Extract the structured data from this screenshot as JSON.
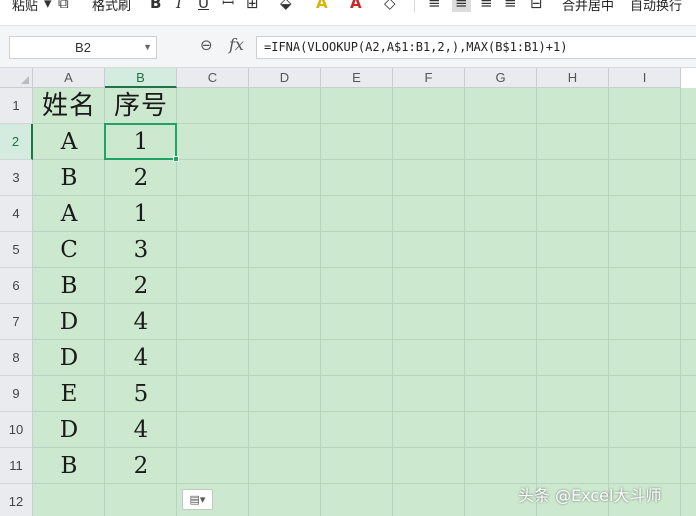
{
  "toolbar": {
    "paste_label": "粘贴",
    "format_painter_label": "格式刷",
    "merge_center_label": "合并居中",
    "wrap_text_label": "自动换行",
    "bold_label": "B",
    "italic_label": "I",
    "underline_label": "U",
    "font_color_label": "A",
    "highlight_label": "A"
  },
  "formula_bar": {
    "name_box": "B2",
    "fx_label": "fx",
    "formula": "=IFNA(VLOOKUP(A2,A$1:B1,2,),MAX(B$1:B1)+1)"
  },
  "columns": [
    "A",
    "B",
    "C",
    "D",
    "E",
    "F",
    "G",
    "H",
    "I"
  ],
  "rows": [
    "1",
    "2",
    "3",
    "4",
    "5",
    "6",
    "7",
    "8",
    "9",
    "10",
    "11",
    "12"
  ],
  "active_cell": {
    "column": "B",
    "row": "2"
  },
  "table": {
    "headers": [
      "姓名",
      "序号"
    ],
    "rows": [
      [
        "A",
        "1"
      ],
      [
        "B",
        "2"
      ],
      [
        "A",
        "1"
      ],
      [
        "C",
        "3"
      ],
      [
        "B",
        "2"
      ],
      [
        "D",
        "4"
      ],
      [
        "D",
        "4"
      ],
      [
        "E",
        "5"
      ],
      [
        "D",
        "4"
      ],
      [
        "B",
        "2"
      ]
    ]
  },
  "watermark": "头条 @Excel大斗师",
  "colors": {
    "sheet_background": "#cce8cf",
    "selection": "#21a366",
    "header_active": "#217346"
  }
}
